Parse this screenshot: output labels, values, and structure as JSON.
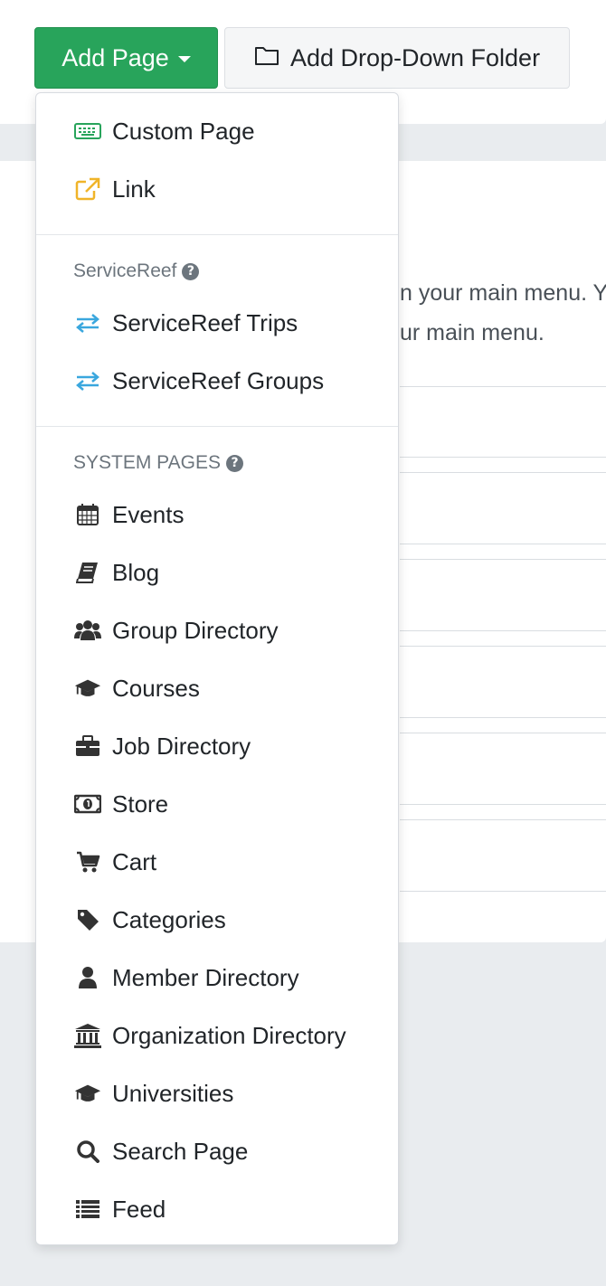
{
  "toolbar": {
    "add_page_label": "Add Page",
    "add_folder_label": "Add Drop-Down Folder"
  },
  "background": {
    "line1": "n your main menu. Y",
    "line2": "ur main menu."
  },
  "dropdown": {
    "top_items": [
      {
        "label": "Custom Page",
        "icon": "keyboard-icon"
      },
      {
        "label": "Link",
        "icon": "external-link-icon"
      }
    ],
    "servicereef": {
      "header": "ServiceReef",
      "items": [
        {
          "label": "ServiceReef Trips",
          "icon": "exchange-icon"
        },
        {
          "label": "ServiceReef Groups",
          "icon": "exchange-icon"
        }
      ]
    },
    "system_pages": {
      "header": "SYSTEM PAGES",
      "items": [
        {
          "label": "Events",
          "icon": "calendar-icon"
        },
        {
          "label": "Blog",
          "icon": "book-icon"
        },
        {
          "label": "Group Directory",
          "icon": "users-icon"
        },
        {
          "label": "Courses",
          "icon": "graduation-cap-icon"
        },
        {
          "label": "Job Directory",
          "icon": "briefcase-icon"
        },
        {
          "label": "Store",
          "icon": "money-icon"
        },
        {
          "label": "Cart",
          "icon": "cart-icon"
        },
        {
          "label": "Categories",
          "icon": "tag-icon"
        },
        {
          "label": "Member Directory",
          "icon": "user-icon"
        },
        {
          "label": "Organization Directory",
          "icon": "institution-icon"
        },
        {
          "label": "Universities",
          "icon": "graduation-cap-icon"
        },
        {
          "label": "Search Page",
          "icon": "search-icon"
        },
        {
          "label": "Feed",
          "icon": "list-icon"
        }
      ]
    }
  },
  "colors": {
    "primary_button": "#28a45b",
    "keyboard_icon": "#28a45b",
    "link_icon": "#f0b429",
    "exchange_icon": "#3aa7de",
    "text": "#212529",
    "muted": "#6c757d"
  }
}
